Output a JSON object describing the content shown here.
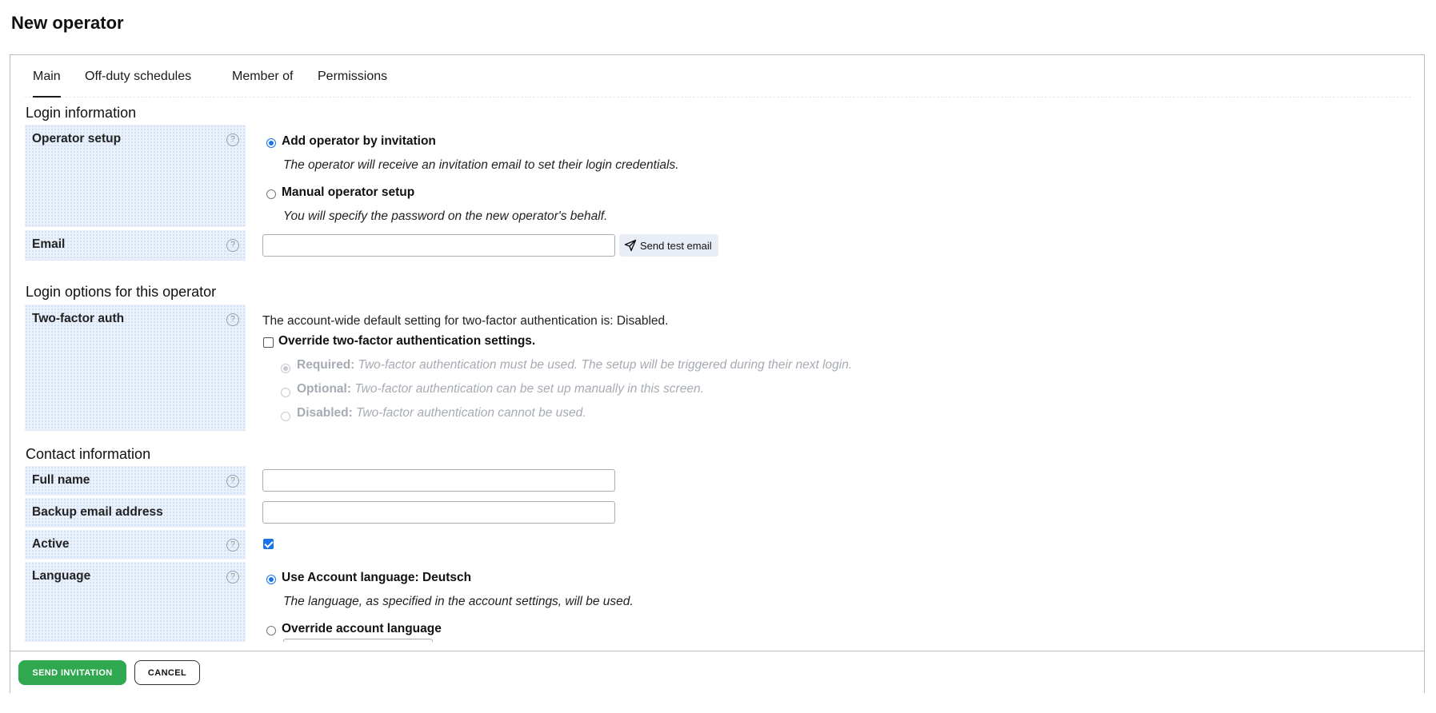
{
  "page": {
    "title": "New operator"
  },
  "tabs": [
    {
      "label": "Main",
      "active": true
    },
    {
      "label": "Off-duty schedules"
    },
    {
      "label": "Member of"
    },
    {
      "label": "Permissions"
    }
  ],
  "login_info": {
    "section_title": "Login information",
    "operator_setup": {
      "label": "Operator setup",
      "options": [
        {
          "label": "Add operator by invitation",
          "description": "The operator will receive an invitation email to set their login credentials.",
          "selected": true
        },
        {
          "label": "Manual operator setup",
          "description": "You will specify the password on the new operator's behalf.",
          "selected": false
        }
      ]
    },
    "email": {
      "label": "Email",
      "value": "",
      "test_button": "Send test email"
    }
  },
  "login_options": {
    "section_title": "Login options for this operator",
    "two_factor": {
      "label": "Two-factor auth",
      "default_text": "The account-wide default setting for two-factor authentication is: Disabled.",
      "override_label": "Override two-factor authentication settings.",
      "override_checked": false,
      "options": [
        {
          "name": "Required:",
          "description": "Two-factor authentication must be used. The setup will be triggered during their next login.",
          "selected": true
        },
        {
          "name": "Optional:",
          "description": "Two-factor authentication can be set up manually in this screen.",
          "selected": false
        },
        {
          "name": "Disabled:",
          "description": "Two-factor authentication cannot be used.",
          "selected": false
        }
      ]
    }
  },
  "contact": {
    "section_title": "Contact information",
    "full_name": {
      "label": "Full name",
      "value": ""
    },
    "backup_email": {
      "label": "Backup email address",
      "value": ""
    },
    "active": {
      "label": "Active",
      "checked": true
    },
    "language": {
      "label": "Language",
      "options": [
        {
          "label": "Use Account language: Deutsch",
          "description": "The language, as specified in the account settings, will be used.",
          "selected": true
        },
        {
          "label": "Override account language",
          "selected": false
        }
      ]
    }
  },
  "footer": {
    "primary_button": "SEND INVITATION",
    "cancel_button": "CANCEL"
  },
  "icons": {
    "help": "help-circle-icon",
    "send": "paper-plane-icon"
  },
  "colors": {
    "primary": "#2fa84f",
    "accent": "#1a73e8",
    "label_background": "#eaf1fb"
  }
}
